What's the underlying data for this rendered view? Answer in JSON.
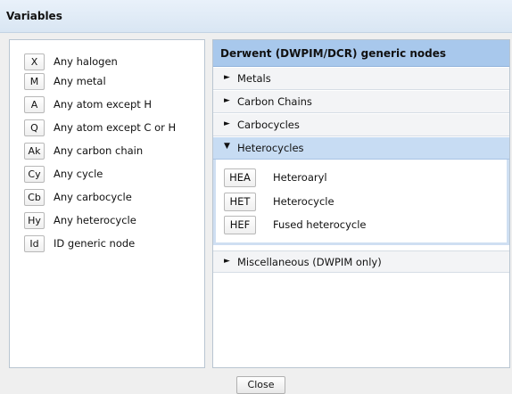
{
  "dialog": {
    "title": "Variables",
    "close_label": "Close"
  },
  "variables": [
    {
      "code": "X",
      "label": "Any halogen"
    },
    {
      "code": "M",
      "label": "Any metal"
    },
    {
      "code": "A",
      "label": "Any atom except H"
    },
    {
      "code": "Q",
      "label": "Any atom except C or H"
    },
    {
      "code": "Ak",
      "label": "Any carbon chain"
    },
    {
      "code": "Cy",
      "label": "Any cycle"
    },
    {
      "code": "Cb",
      "label": "Any carbocycle"
    },
    {
      "code": "Hy",
      "label": "Any heterocycle"
    },
    {
      "code": "Id",
      "label": "ID generic node"
    }
  ],
  "generic_nodes": {
    "title": "Derwent (DWPIM/DCR) generic nodes",
    "sections": [
      {
        "label": "Metals",
        "arrow": "►",
        "expanded": false
      },
      {
        "label": "Carbon Chains",
        "arrow": "►",
        "expanded": false
      },
      {
        "label": "Carbocycles",
        "arrow": "►",
        "expanded": false
      },
      {
        "label": "Heterocycles",
        "arrow": "▼",
        "expanded": true
      },
      {
        "label": "Miscellaneous (DWPIM only)",
        "arrow": "►",
        "expanded": false
      }
    ],
    "heterocycle_items": [
      {
        "code": "HEA",
        "label": "Heteroaryl"
      },
      {
        "code": "HET",
        "label": "Heterocycle"
      },
      {
        "code": "HEF",
        "label": "Fused heterocycle"
      }
    ]
  },
  "colors": {
    "header_blue": "#a8c8ec",
    "active_section": "#c7dcf3"
  }
}
